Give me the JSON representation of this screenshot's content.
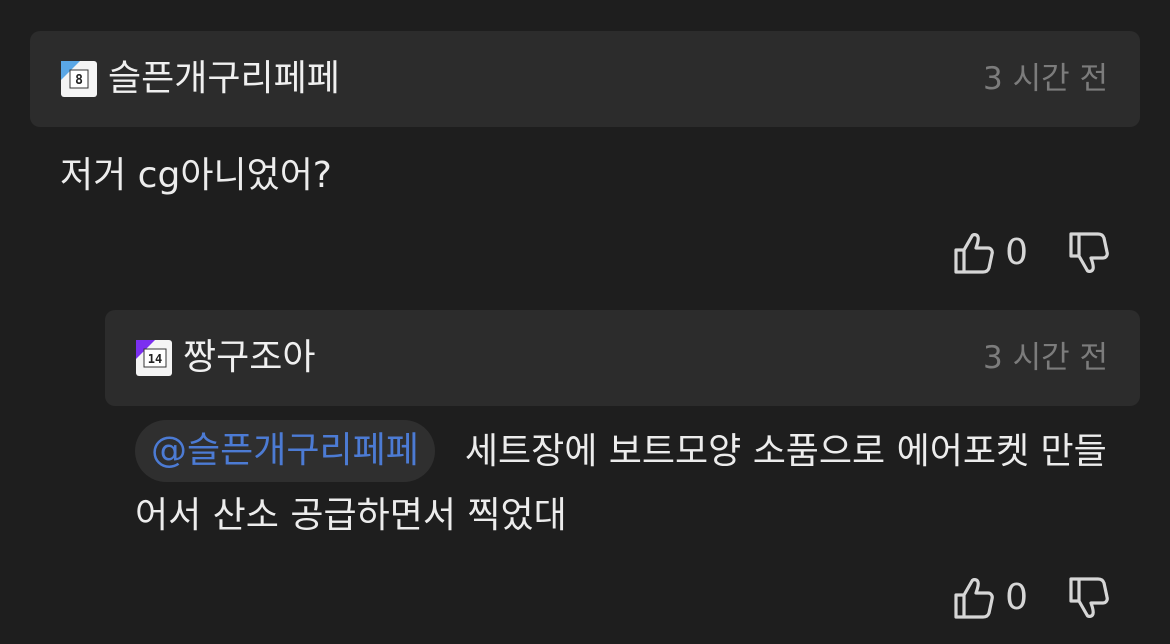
{
  "comments": [
    {
      "author": "슬픈개구리페페",
      "level_badge": "8",
      "timestamp": "3 시간 전",
      "text": "저거 cg아니었어?",
      "likes": "0",
      "icons": {
        "like": "thumbs-up-icon",
        "dislike": "thumbs-down-icon"
      }
    },
    {
      "author": "짱구조아",
      "level_badge": "14",
      "timestamp": "3 시간 전",
      "mention": "@슬픈개구리페페",
      "text": "세트장에 보트모양 소품으로 에어포켓 만들어서 산소 공급하면서 찍었대",
      "likes": "0",
      "icons": {
        "like": "thumbs-up-icon",
        "dislike": "thumbs-down-icon"
      }
    }
  ],
  "colors": {
    "background": "#1e1e1e",
    "header_background": "#2c2c2c",
    "timestamp": "#7c7c7c",
    "mention": "#4c7bd4",
    "mention_background": "#2f2f2f"
  }
}
